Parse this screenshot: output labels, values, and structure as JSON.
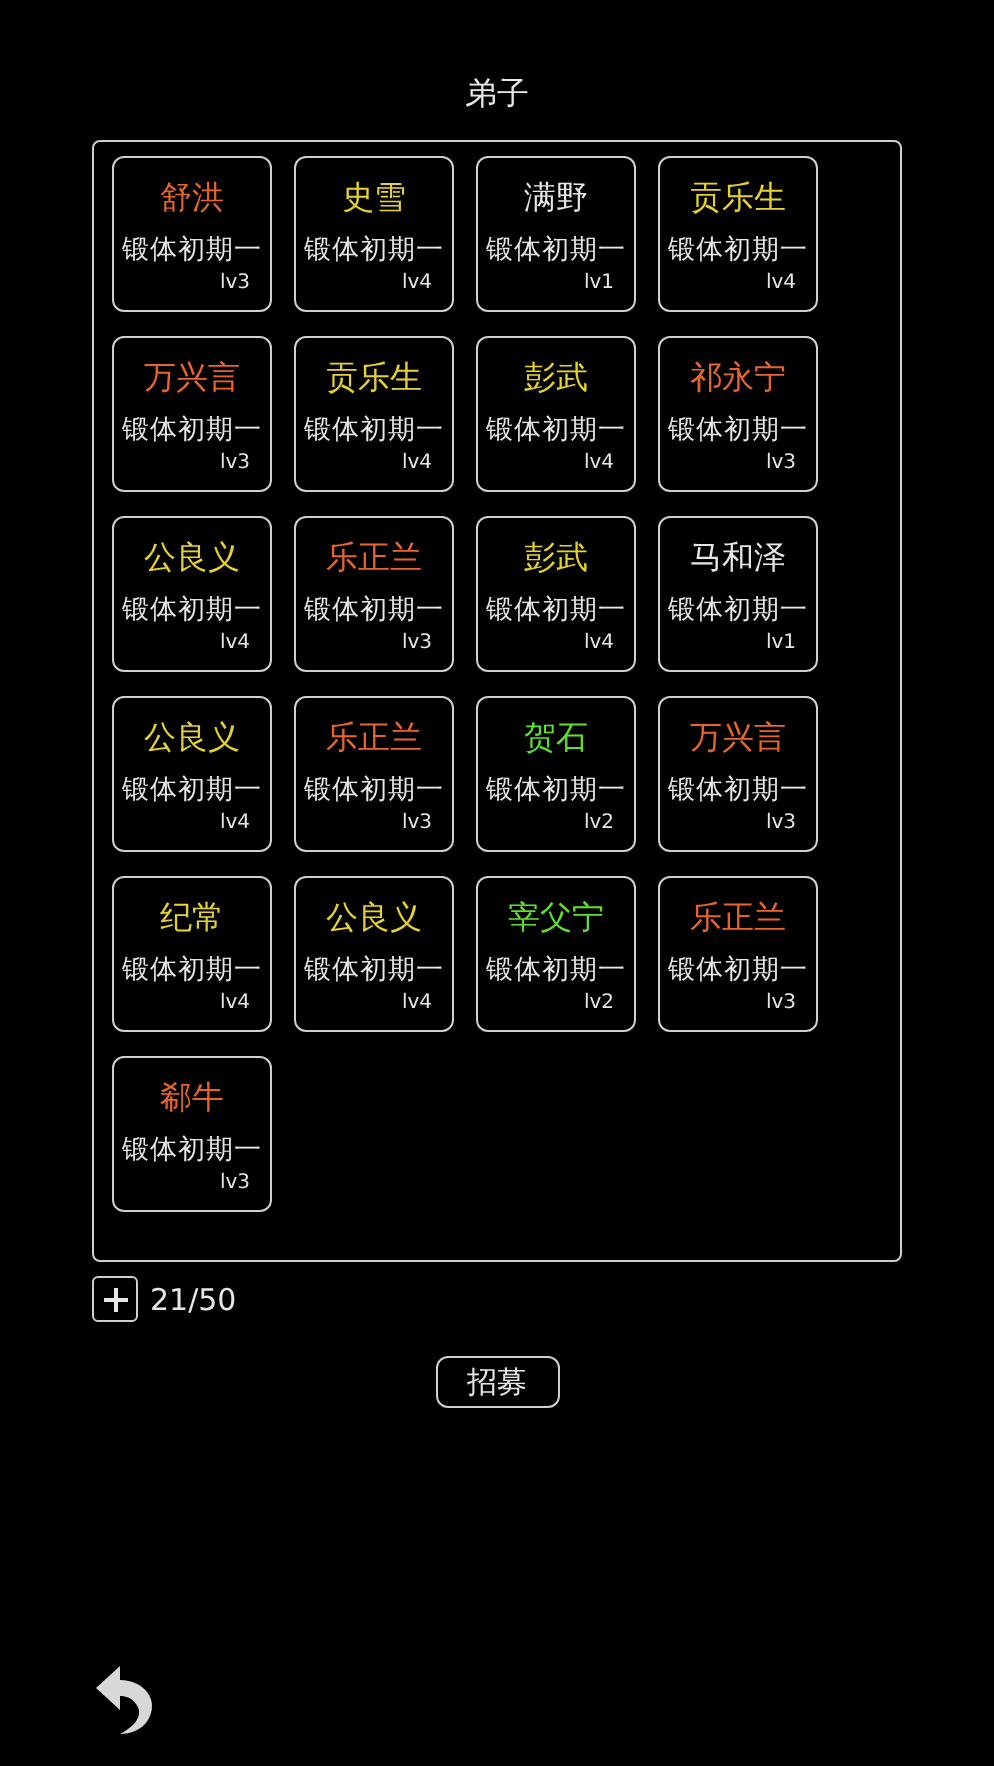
{
  "title": "弟子",
  "disciples": [
    {
      "name": "舒洪",
      "color": "#e8642a",
      "rank": "锻体初期一",
      "level": "lv3"
    },
    {
      "name": "史雪",
      "color": "#e6d22c",
      "rank": "锻体初期一",
      "level": "lv4"
    },
    {
      "name": "满野",
      "color": "#e6e6e6",
      "rank": "锻体初期一",
      "level": "lv1"
    },
    {
      "name": "贡乐生",
      "color": "#e6d22c",
      "rank": "锻体初期一",
      "level": "lv4"
    },
    {
      "name": "万兴言",
      "color": "#e8642a",
      "rank": "锻体初期一",
      "level": "lv3"
    },
    {
      "name": "贡乐生",
      "color": "#e6d22c",
      "rank": "锻体初期一",
      "level": "lv4"
    },
    {
      "name": "彭武",
      "color": "#e6d22c",
      "rank": "锻体初期一",
      "level": "lv4"
    },
    {
      "name": "祁永宁",
      "color": "#e8642a",
      "rank": "锻体初期一",
      "level": "lv3"
    },
    {
      "name": "公良义",
      "color": "#e6d22c",
      "rank": "锻体初期一",
      "level": "lv4"
    },
    {
      "name": "乐正兰",
      "color": "#e8642a",
      "rank": "锻体初期一",
      "level": "lv3"
    },
    {
      "name": "彭武",
      "color": "#e6d22c",
      "rank": "锻体初期一",
      "level": "lv4"
    },
    {
      "name": "马和泽",
      "color": "#e6e6e6",
      "rank": "锻体初期一",
      "level": "lv1"
    },
    {
      "name": "公良义",
      "color": "#e6d22c",
      "rank": "锻体初期一",
      "level": "lv4"
    },
    {
      "name": "乐正兰",
      "color": "#e8642a",
      "rank": "锻体初期一",
      "level": "lv3"
    },
    {
      "name": "贺石",
      "color": "#5ee02a",
      "rank": "锻体初期一",
      "level": "lv2"
    },
    {
      "name": "万兴言",
      "color": "#e8642a",
      "rank": "锻体初期一",
      "level": "lv3"
    },
    {
      "name": "纪常",
      "color": "#e6d22c",
      "rank": "锻体初期一",
      "level": "lv4"
    },
    {
      "name": "公良义",
      "color": "#e6d22c",
      "rank": "锻体初期一",
      "level": "lv4"
    },
    {
      "name": "宰父宁",
      "color": "#5ee02a",
      "rank": "锻体初期一",
      "level": "lv2"
    },
    {
      "name": "乐正兰",
      "color": "#e8642a",
      "rank": "锻体初期一",
      "level": "lv3"
    },
    {
      "name": "郗牛",
      "color": "#e8642a",
      "rank": "锻体初期一",
      "level": "lv3"
    }
  ],
  "capacity": "21/50",
  "recruit_button": "招募"
}
